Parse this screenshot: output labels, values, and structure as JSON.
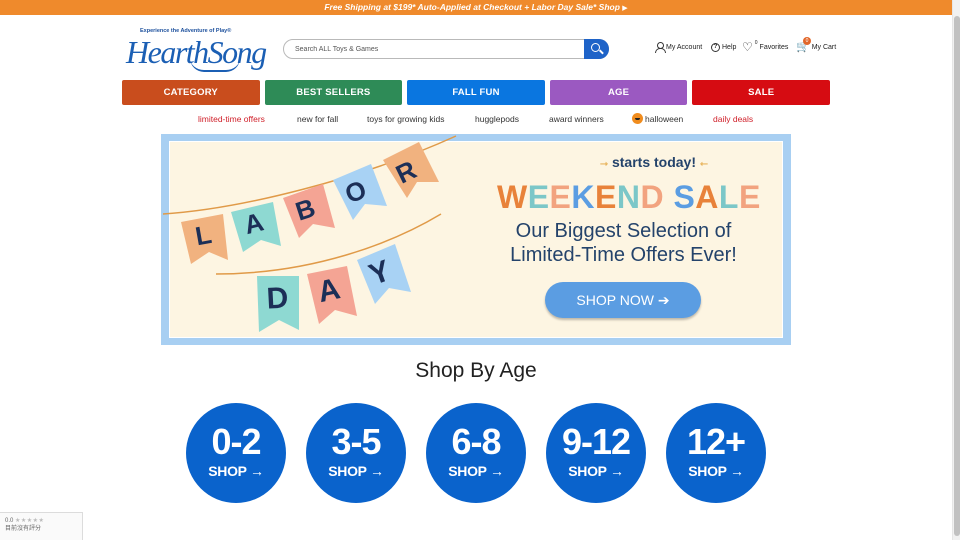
{
  "promo": {
    "text": "Free Shipping at $199* Auto-Applied at Checkout + Labor Day Sale* Shop",
    "arrow": "▶"
  },
  "logo": {
    "tagline": "Experience the Adventure of Play®",
    "name": "HearthSong"
  },
  "search": {
    "placeholder": "Search ALL Toys & Games"
  },
  "header_links": {
    "account": "My Account",
    "help": "Help",
    "favorites": "Favorites",
    "favorites_count": "0",
    "cart": "My Cart",
    "cart_count": "0"
  },
  "categories": [
    "CATEGORY",
    "BEST SELLERS",
    "FALL FUN",
    "AGE",
    "SALE"
  ],
  "category_colors": [
    "#c94d1d",
    "#2e8b57",
    "#0a76e0",
    "#9b59c1",
    "#d60c12"
  ],
  "subnav": [
    "limited-time offers",
    "new for fall",
    "toys for growing kids",
    "hugglepods",
    "award winners",
    "halloween",
    "daily deals"
  ],
  "hero": {
    "flags_row1": [
      "L",
      "A",
      "B",
      "O",
      "R"
    ],
    "flags_row2": [
      "D",
      "A",
      "Y"
    ],
    "starts": "starts today!",
    "headline": "WEEKEND SALE",
    "line1": "Our Biggest Selection of",
    "line2": "Limited-Time Offers Ever!",
    "button": "SHOP NOW ➔"
  },
  "shop_by_age": {
    "title": "Shop By Age",
    "items": [
      {
        "range": "0-2",
        "label": "SHOP →"
      },
      {
        "range": "3-5",
        "label": "SHOP →"
      },
      {
        "range": "6-8",
        "label": "SHOP →"
      },
      {
        "range": "9-12",
        "label": "SHOP →"
      },
      {
        "range": "12+",
        "label": "SHOP →"
      }
    ]
  },
  "rating_widget": {
    "score": "0.0",
    "stars": "★★★★★",
    "text": "目前沒有評分"
  },
  "colors": {
    "promo": "#ef8a2c",
    "brand_blue": "#0a63cc",
    "hero_border": "#a8cff2"
  }
}
